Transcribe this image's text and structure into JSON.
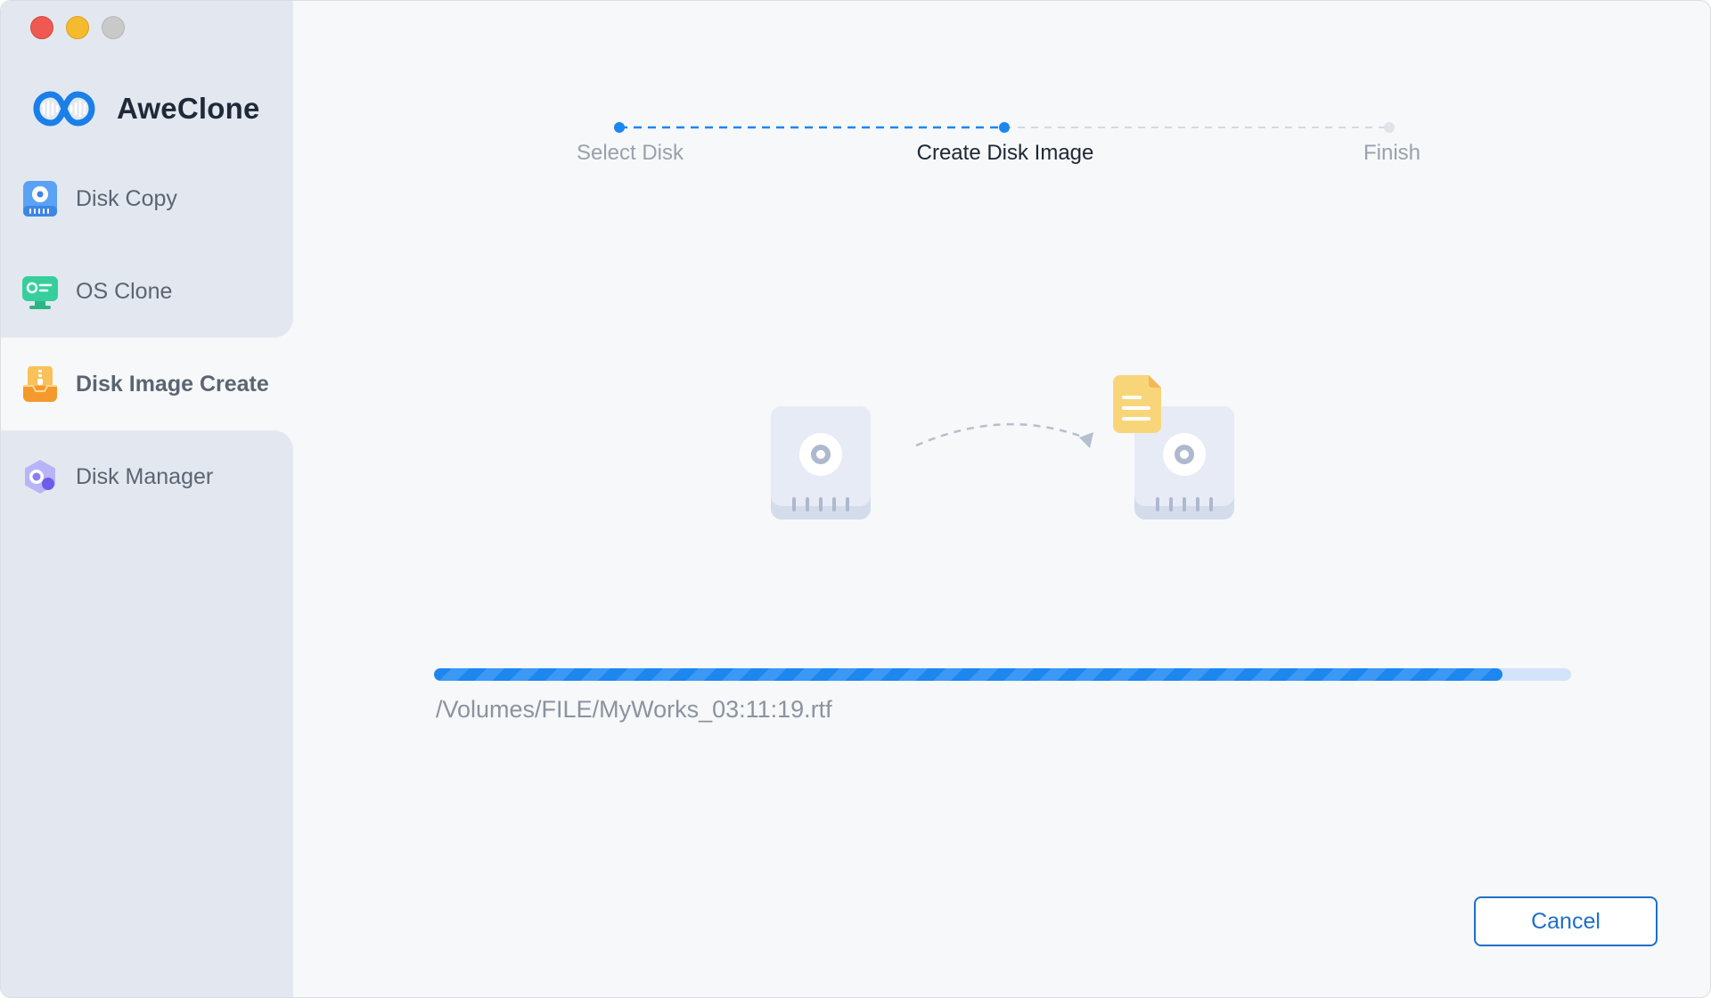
{
  "app": {
    "name": "AweClone"
  },
  "window_controls": [
    "close",
    "minimize",
    "zoom"
  ],
  "sidebar": {
    "items": [
      {
        "label": "Disk Copy",
        "icon": "disk-copy-icon",
        "active": false
      },
      {
        "label": "OS Clone",
        "icon": "os-clone-icon",
        "active": false
      },
      {
        "label": "Disk Image Create",
        "icon": "disk-image-create-icon",
        "active": true
      },
      {
        "label": "Disk Manager",
        "icon": "disk-manager-icon",
        "active": false
      }
    ]
  },
  "steps": [
    {
      "label": "Select Disk",
      "state": "done"
    },
    {
      "label": "Create Disk Image",
      "state": "current"
    },
    {
      "label": "Finish",
      "state": "pending"
    }
  ],
  "illustration": {
    "source": "hard-disk-icon",
    "arrow": "dashed-arrow-icon",
    "target": "hard-disk-with-document-icon"
  },
  "progress": {
    "fraction": 0.94,
    "current_file": "/Volumes/FILE/MyWorks_03:11:19.rtf"
  },
  "actions": {
    "cancel_label": "Cancel"
  },
  "colors": {
    "accent": "#1d86ef",
    "sidebar_bg": "#e3e8f0",
    "content_bg": "#f6f8fa",
    "document_yellow": "#f9d57a"
  }
}
